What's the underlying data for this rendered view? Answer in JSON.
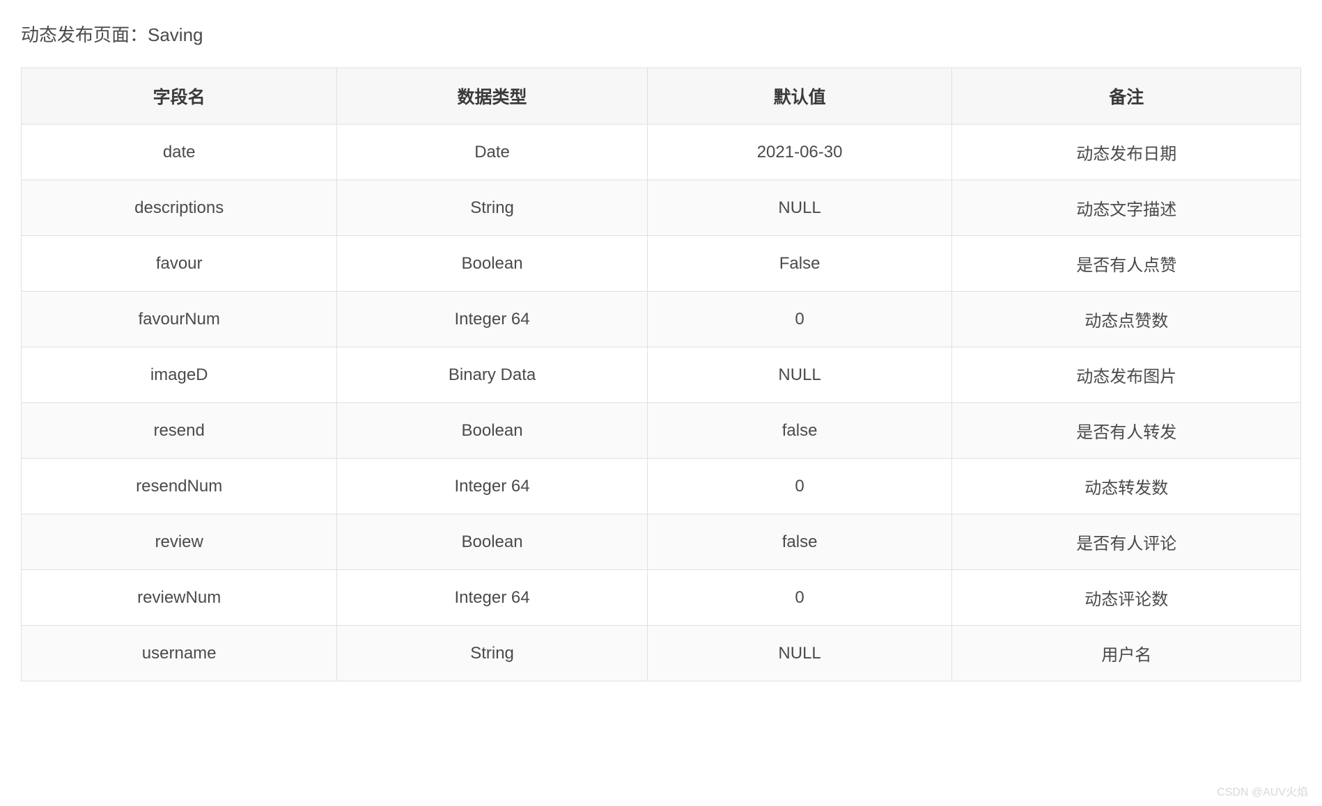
{
  "title": "动态发布页面：Saving",
  "table": {
    "headers": [
      "字段名",
      "数据类型",
      "默认值",
      "备注"
    ],
    "rows": [
      {
        "field": "date",
        "type": "Date",
        "default": "2021-06-30",
        "note": "动态发布日期"
      },
      {
        "field": "descriptions",
        "type": "String",
        "default": "NULL",
        "note": "动态文字描述"
      },
      {
        "field": "favour",
        "type": "Boolean",
        "default": "False",
        "note": "是否有人点赞"
      },
      {
        "field": "favourNum",
        "type": "Integer 64",
        "default": "0",
        "note": "动态点赞数"
      },
      {
        "field": "imageD",
        "type": "Binary Data",
        "default": "NULL",
        "note": "动态发布图片"
      },
      {
        "field": "resend",
        "type": "Boolean",
        "default": "false",
        "note": "是否有人转发"
      },
      {
        "field": "resendNum",
        "type": "Integer 64",
        "default": "0",
        "note": "动态转发数"
      },
      {
        "field": "review",
        "type": "Boolean",
        "default": "false",
        "note": "是否有人评论"
      },
      {
        "field": "reviewNum",
        "type": "Integer 64",
        "default": "0",
        "note": "动态评论数"
      },
      {
        "field": "username",
        "type": "String",
        "default": "NULL",
        "note": "用户名"
      }
    ]
  },
  "watermark": "CSDN @AUV火焰"
}
